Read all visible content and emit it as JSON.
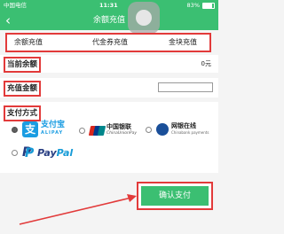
{
  "status_bar": {
    "carrier": "中国电信",
    "time": "11:31",
    "battery": "83%",
    "battery_fraction": 0.83
  },
  "nav": {
    "title": "余额充值",
    "back_icon": "chevron-left-icon"
  },
  "tabs": [
    {
      "label": "余额充值"
    },
    {
      "label": "代金券充值"
    },
    {
      "label": "金块充值"
    }
  ],
  "balance": {
    "label": "当前余额",
    "value": "0元"
  },
  "amount": {
    "label": "充值金额",
    "value": ""
  },
  "payment": {
    "label": "支付方式",
    "options": [
      {
        "name": "alipay",
        "cn": "支付宝",
        "en": "ALIPAY",
        "mark": "支",
        "selected": true
      },
      {
        "name": "unionpay",
        "cn": "中国银联",
        "en": "ChinaUnionPay",
        "selected": false
      },
      {
        "name": "chinabank",
        "cn": "网银在线",
        "en": "Chinabank payments",
        "selected": false
      },
      {
        "name": "paypal",
        "word_a": "Pay",
        "word_b": "Pal",
        "mark": "P",
        "selected": false
      }
    ]
  },
  "confirm": {
    "label": "确认支付"
  },
  "colors": {
    "brand_green": "#3bbf72",
    "annotation_red": "#e23a3a"
  }
}
